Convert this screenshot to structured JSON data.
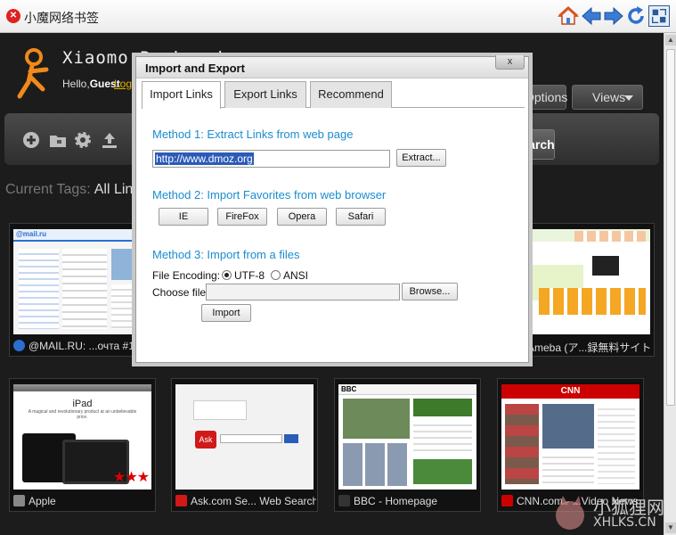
{
  "window": {
    "title": "小魔网络书签",
    "app_icon_glyph": "✕",
    "buttons": [
      "home-icon",
      "back-arrow-icon",
      "forward-arrow-icon",
      "refresh-icon",
      "restore-window-icon"
    ]
  },
  "header": {
    "brand": "Xiaomo Bookmarks",
    "hello": "Hello,",
    "user": "Guest",
    "login_link": "Login"
  },
  "top_tabs": {
    "options_label": "Options",
    "views_label": "Views"
  },
  "toolbar": {
    "icons": [
      "add-icon",
      "folder-icon",
      "gear-icon",
      "upload-icon"
    ],
    "search_label": "Search"
  },
  "tags": {
    "label": "Current Tags:",
    "current": "All Links"
  },
  "thumbnails": [
    {
      "caption": "@MAIL.RU: ...очта #1",
      "icon_color": "#2a6fd0"
    },
    {
      "caption": "Ameba (ア...録無料サイト",
      "icon_color": "#5aa032"
    },
    {
      "caption": "Apple",
      "icon_color": "#888888"
    },
    {
      "caption": "Ask.com Se... Web Search",
      "icon_color": "#d11919"
    },
    {
      "caption": "BBC - Homepage",
      "icon_color": "#333333"
    },
    {
      "caption": "CNN.com - ...Video News",
      "icon_color": "#cc0000"
    }
  ],
  "thumb_texts": {
    "mailru": "@mail.ru",
    "ipad": "iPad",
    "ipad_sub": "A magical and revolutionary product at an unbelievable price.",
    "ask": "Ask",
    "bbc": "BBC",
    "cnn": "CNN"
  },
  "modal": {
    "title": "Import and Export",
    "close": "x",
    "tabs": [
      "Import Links",
      "Export Links",
      "Recommend"
    ],
    "method1": "Method 1: Extract Links from web page",
    "url_value": "http://www.dmoz.org",
    "extract_button": "Extract...",
    "method2": "Method 2: Import Favorites from web browser",
    "browsers": [
      "IE",
      "FireFox",
      "Opera",
      "Safari"
    ],
    "method3": "Method 3: Import from a files",
    "file_encoding_label": "File Encoding:",
    "encoding_options": [
      "UTF-8",
      "ANSI"
    ],
    "encoding_selected": "UTF-8",
    "choose_file_label": "Choose file:",
    "browse_button": "Browse...",
    "import_button": "Import"
  },
  "watermark": {
    "line1": "小狐狸网",
    "line2": "XHLKS.CN"
  },
  "colors": {
    "accent_blue": "#1a8ccf",
    "login_yellow": "#e0b000",
    "dark_bg": "#1c1c1c"
  }
}
